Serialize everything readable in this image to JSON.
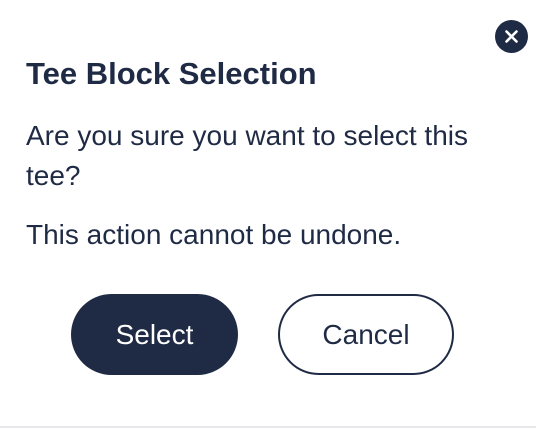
{
  "dialog": {
    "title": "Tee Block Selection",
    "message": "Are you sure you want to select this tee?",
    "warning": "This action cannot be undone.",
    "close_icon": "close-icon"
  },
  "buttons": {
    "select_label": "Select",
    "cancel_label": "Cancel"
  },
  "colors": {
    "primary": "#1f2a44",
    "background": "#ffffff"
  }
}
